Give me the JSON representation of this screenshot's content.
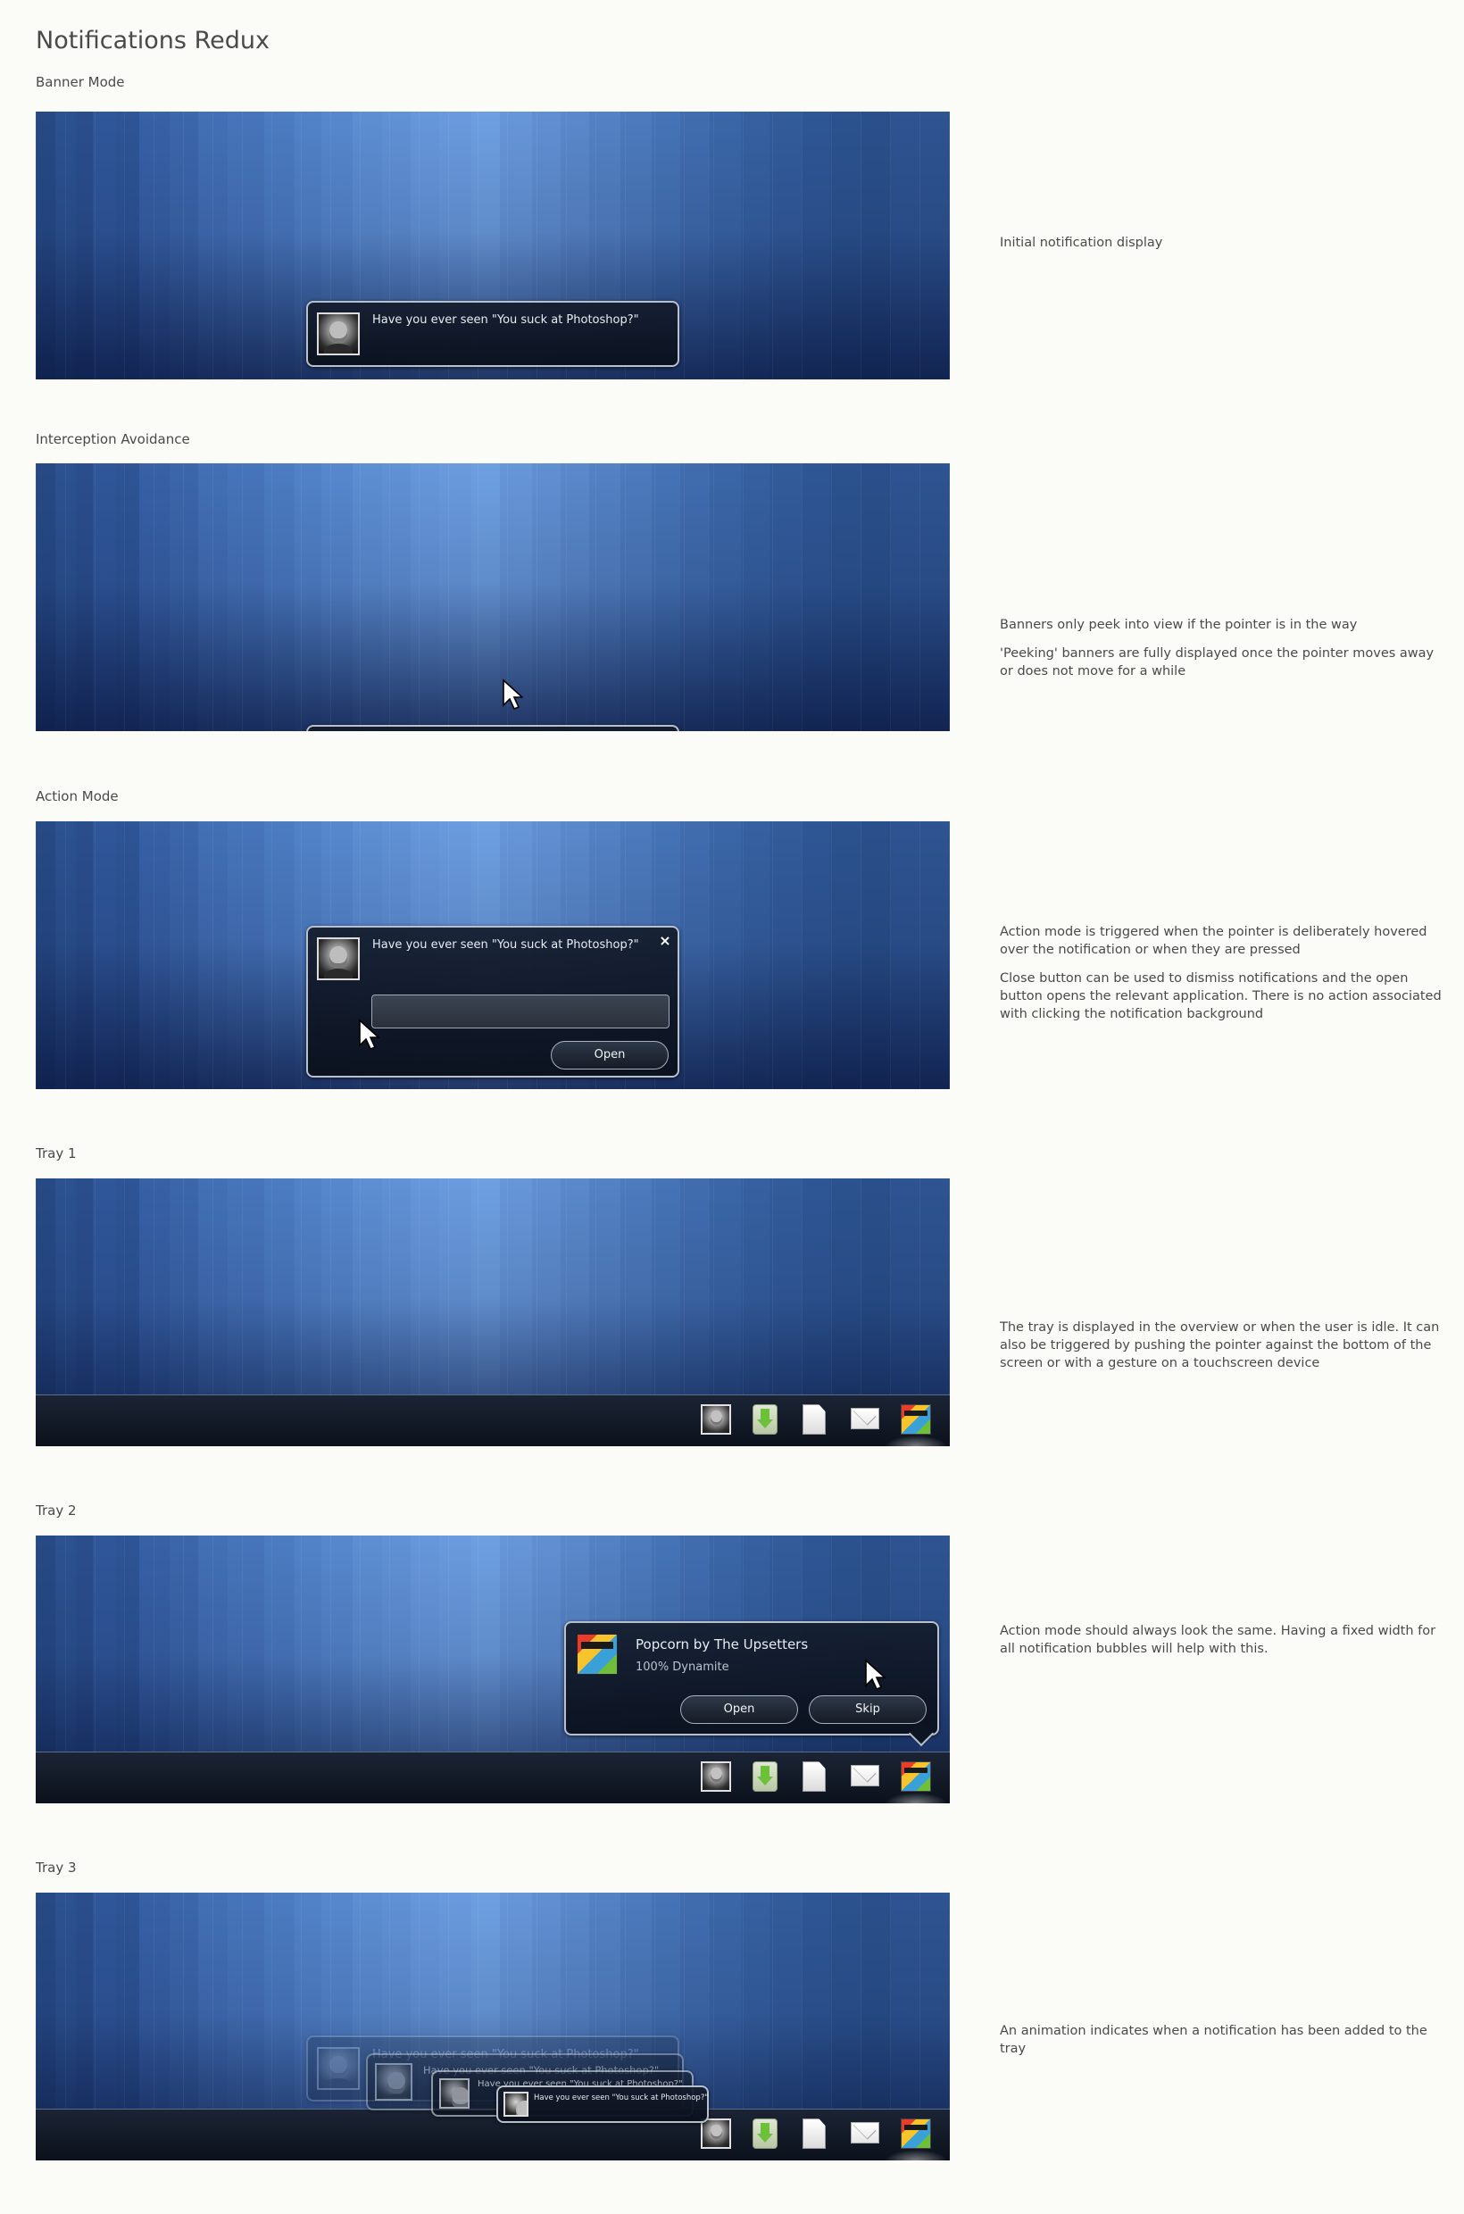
{
  "page_title": "Notifications Redux",
  "sections": {
    "banner": {
      "label": "Banner Mode",
      "description": [
        "Initial notification display"
      ],
      "notification_text": "Have you ever seen \"You suck at Photoshop?\""
    },
    "interception": {
      "label": "Interception Avoidance",
      "description": [
        "Banners only peek into view if the pointer is in the way",
        "'Peeking' banners are fully displayed once the pointer moves away or does not move for a while"
      ]
    },
    "action": {
      "label": "Action Mode",
      "description": [
        "Action mode is triggered when the pointer is deliberately hovered over the notification or when they are pressed",
        "Close button can be used to dismiss notifications and the open button opens the relevant application. There is no action associated with clicking the notification background"
      ],
      "notification_text": "Have you ever seen \"You suck at Photoshop?\"",
      "close_symbol": "×",
      "open_label": "Open"
    },
    "tray1": {
      "label": "Tray 1",
      "description": [
        "The tray is displayed in the overview or when the user is idle. It can also be triggered by pushing the pointer against the bottom of the screen or with a gesture on a touchscreen device"
      ]
    },
    "tray2": {
      "label": "Tray 2",
      "description": [
        " Action mode should always look the same. Having a fixed width for all notification bubbles will help with this."
      ],
      "song_title": "Popcorn by The Upsetters",
      "album_name": "100% Dynamite",
      "open_label": "Open",
      "skip_label": "Skip"
    },
    "tray3": {
      "label": "Tray 3",
      "description": [
        "An animation indicates when a notification has been added to the tray"
      ],
      "notification_text": "Have you ever seen \"You suck at Photoshop?\""
    }
  },
  "tray_icons": [
    "person-avatar",
    "download-icon",
    "document-icon",
    "mail-icon",
    "album-art"
  ],
  "colors": {
    "background": "#fbfbf7",
    "wallpaper_blue": "#4c7cc2",
    "bubble_bg": "#141c2c",
    "bubble_border": "#b8c0cc",
    "tray_bg": "#0c121c"
  }
}
